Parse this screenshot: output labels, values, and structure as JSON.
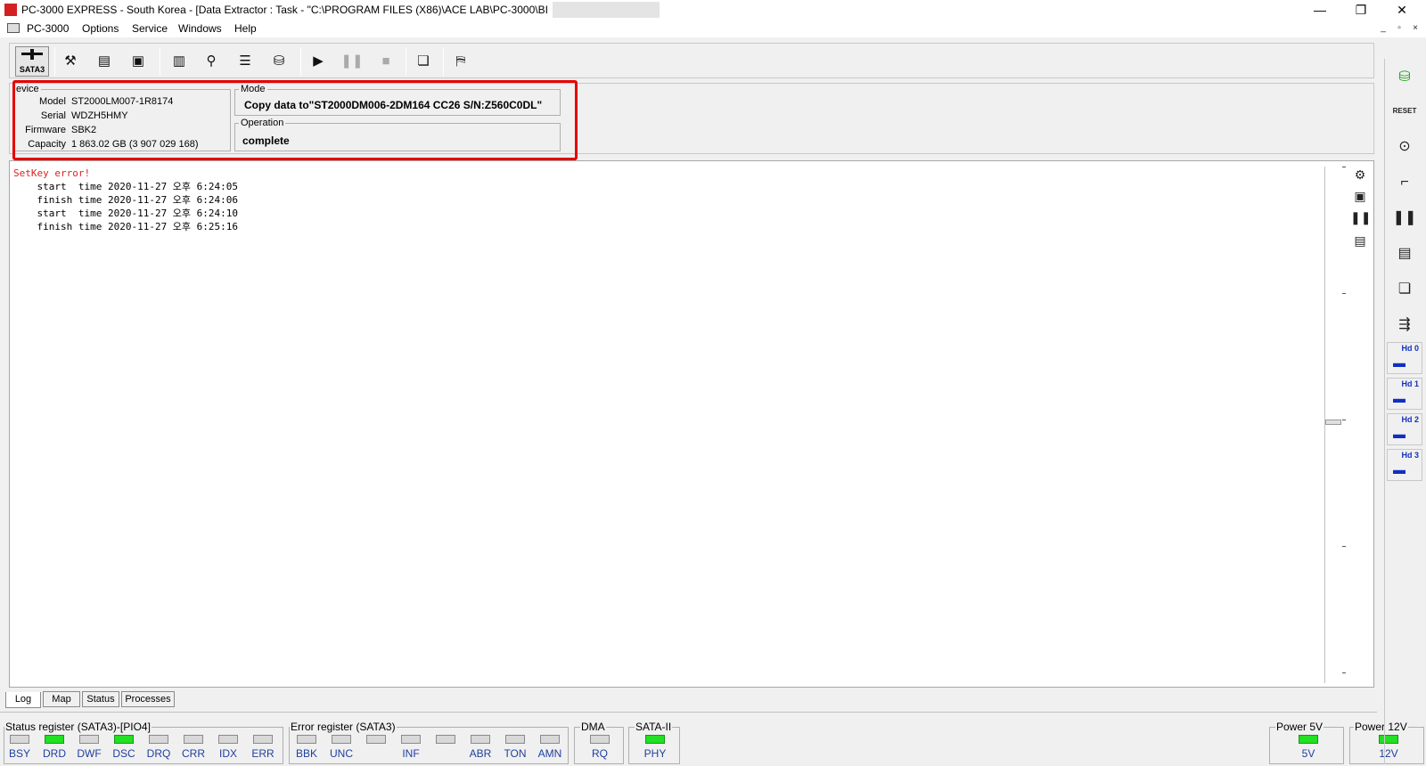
{
  "window": {
    "title": "PC-3000 EXPRESS - South Korea - [Data Extractor : Task - \"C:\\PROGRAM FILES (X86)\\ACE LAB\\PC-3000\\BI",
    "controls": [
      "—",
      "❐",
      "✕"
    ]
  },
  "menu": {
    "items": [
      "PC-3000",
      "Options",
      "Service",
      "Windows",
      "Help"
    ],
    "mdi_controls": [
      "_",
      "▫",
      "×"
    ]
  },
  "toolbar": {
    "interface_label": "SATA3",
    "icons": [
      "tools-icon",
      "rom-icon",
      "percent-icon",
      "sector-edit-icon",
      "binoculars-icon",
      "level-icon",
      "drive-io-icon",
      "play-icon",
      "pause-icon",
      "stop-icon",
      "windows-icon",
      "exit-icon"
    ]
  },
  "device": {
    "group_title": "evice",
    "model_key": "Model",
    "model": "ST2000LM007-1R8174",
    "serial_key": "Serial",
    "serial": "WDZH5HMY",
    "firmware_key": "Firmware",
    "firmware": "SBK2",
    "capacity_key": "Capacity",
    "capacity": "1 863.02 GB (3 907 029 168)"
  },
  "mode": {
    "group_title": "Mode",
    "text": "Copy data to\"ST2000DM006-2DM164 CC26 S/N:Z560C0DL\""
  },
  "operation": {
    "group_title": "Operation",
    "text": "complete"
  },
  "log": {
    "error_line": "SetKey error!",
    "lines": [
      "    start  time 2020-11-27 오후 6:24:05",
      "    finish time 2020-11-27 오후 6:24:06",
      "    start  time 2020-11-27 오후 6:24:10",
      "    finish time 2020-11-27 오후 6:25:16"
    ]
  },
  "tabs": [
    "Log",
    "Map",
    "Status",
    "Processes"
  ],
  "status_register": {
    "title": "Status register (SATA3)-[PIO4]",
    "leds": [
      {
        "label": "BSY",
        "on": false
      },
      {
        "label": "DRD",
        "on": true
      },
      {
        "label": "DWF",
        "on": false
      },
      {
        "label": "DSC",
        "on": true
      },
      {
        "label": "DRQ",
        "on": false
      },
      {
        "label": "CRR",
        "on": false
      },
      {
        "label": "IDX",
        "on": false
      },
      {
        "label": "ERR",
        "on": false
      }
    ]
  },
  "error_register": {
    "title": "Error register (SATA3)",
    "leds": [
      {
        "label": "BBK",
        "on": false
      },
      {
        "label": "UNC",
        "on": false
      },
      {
        "label": "",
        "on": false
      },
      {
        "label": "INF",
        "on": false
      },
      {
        "label": "",
        "on": false
      },
      {
        "label": "ABR",
        "on": false
      },
      {
        "label": "TON",
        "on": false
      },
      {
        "label": "AMN",
        "on": false
      }
    ]
  },
  "dma": {
    "title": "DMA",
    "label": "RQ",
    "on": false
  },
  "sata": {
    "title": "SATA-II",
    "label": "PHY",
    "on": true
  },
  "power5": {
    "title": "Power 5V",
    "label": "5V",
    "on": true
  },
  "power12": {
    "title": "Power 12V",
    "label": "12V",
    "on": true
  },
  "rightbar": {
    "icons": [
      "database-icon",
      "reset-icon",
      "pin-icon",
      "connect-icon",
      "pause-icon",
      "rom-loader-icon",
      "copy-remove-icon",
      "cable-icon"
    ],
    "reset_label": "RESET",
    "hd_buttons": [
      "Hd 0",
      "Hd 1",
      "Hd 2",
      "Hd 3"
    ]
  },
  "colors": {
    "accent_red": "#e60000",
    "led_on": "#22e022",
    "label_blue": "#1f3f9f"
  }
}
